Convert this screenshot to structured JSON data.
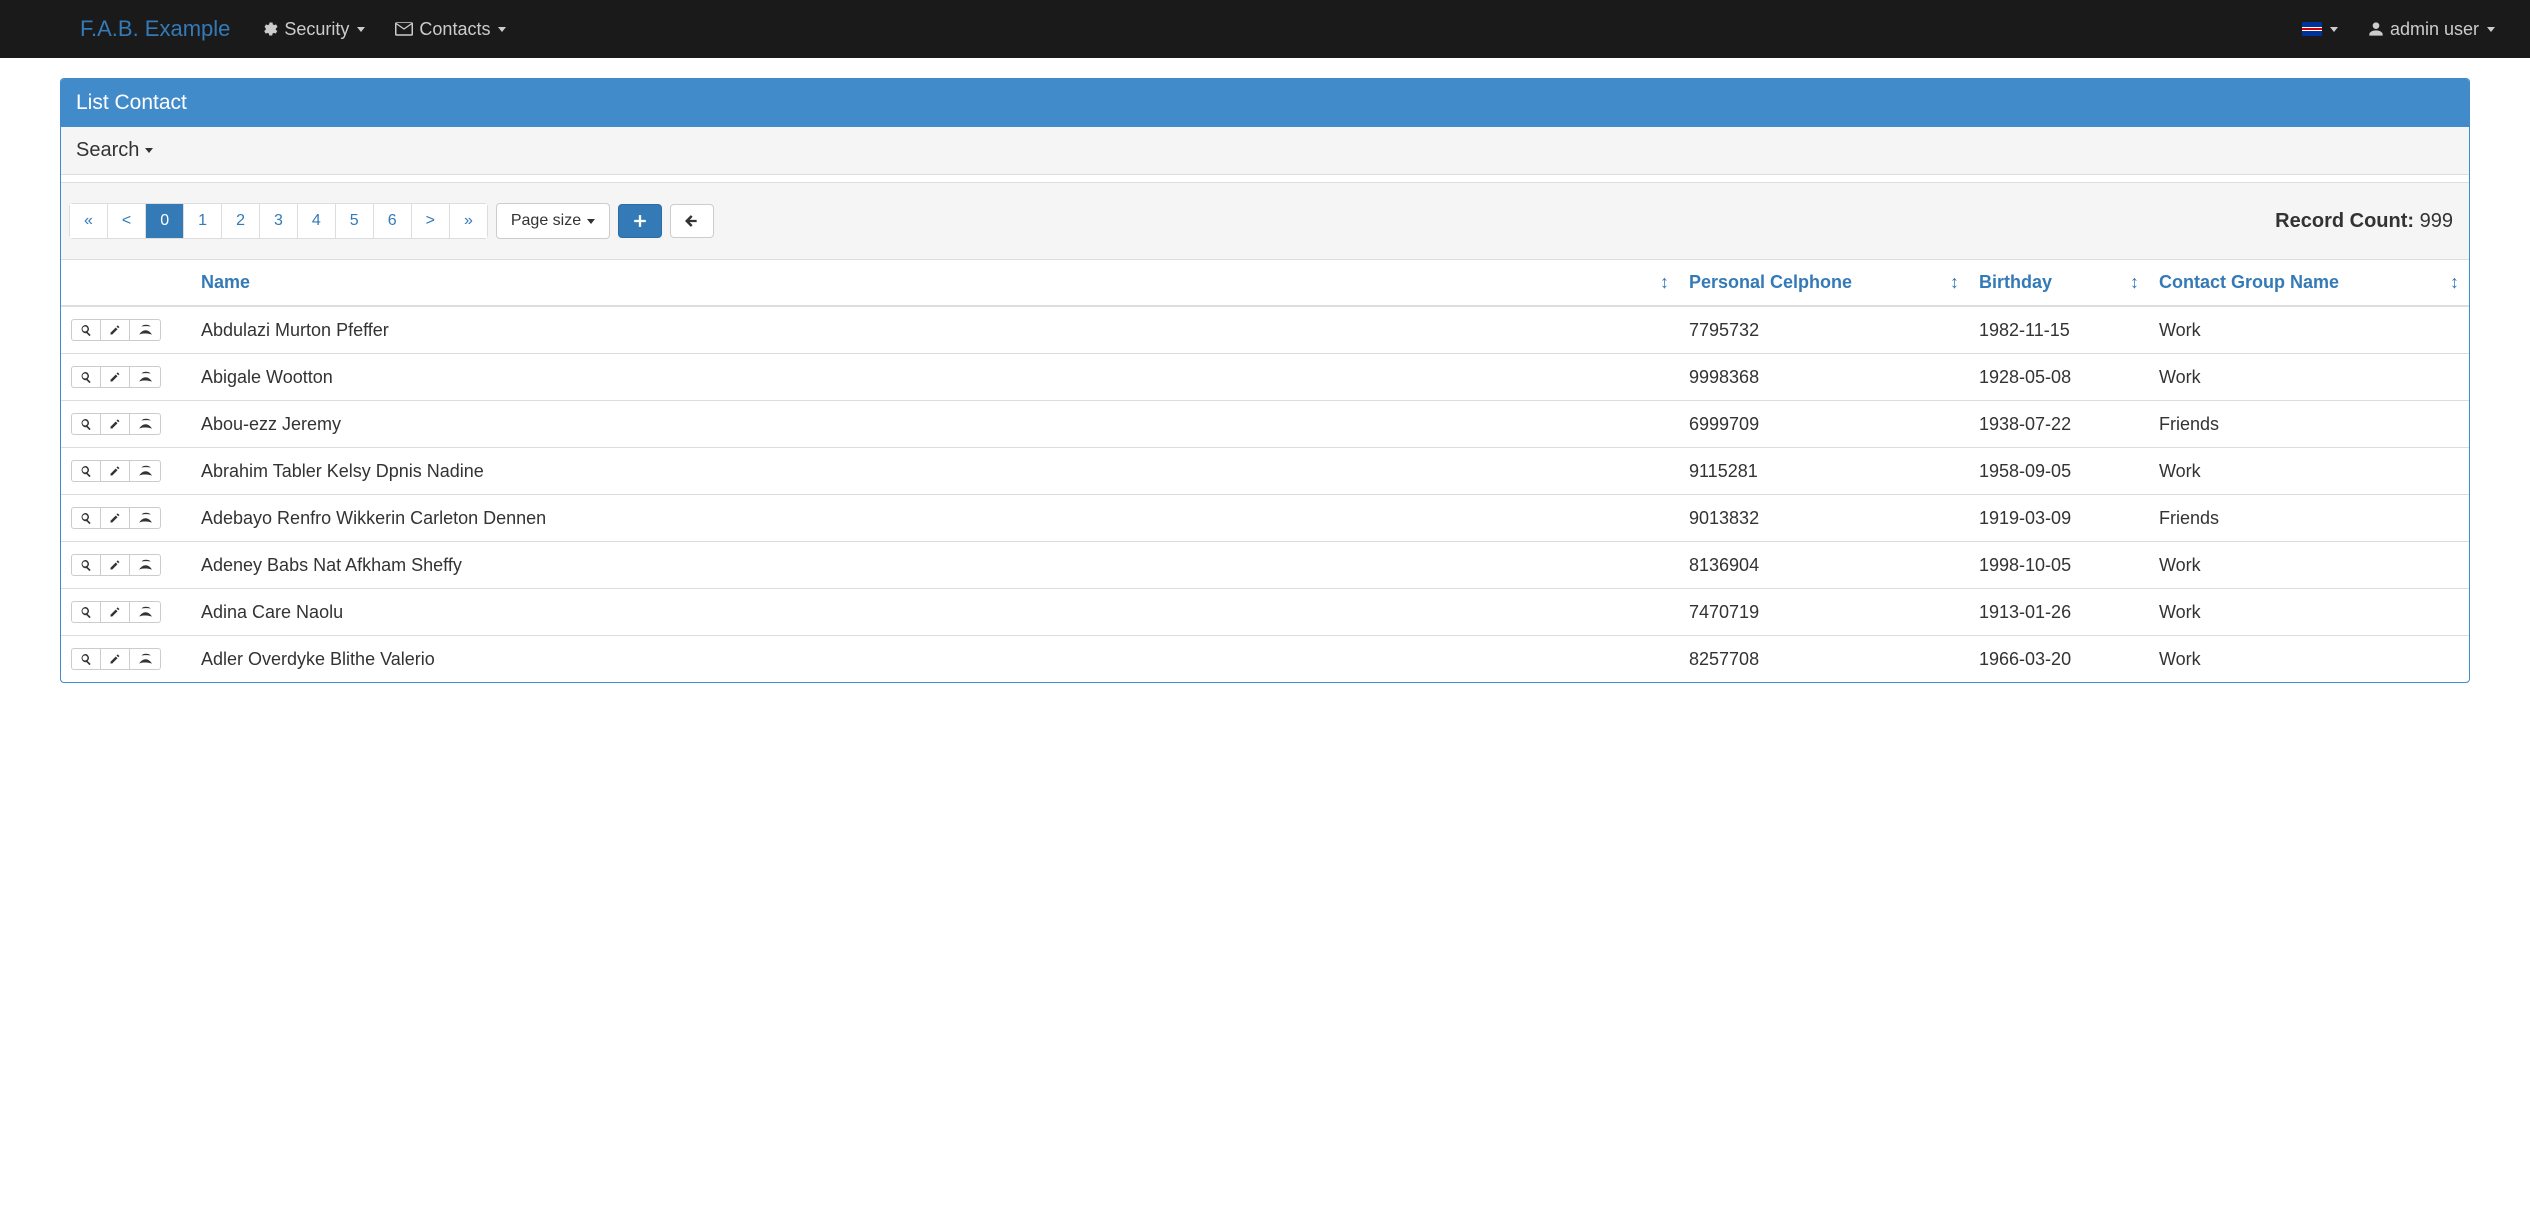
{
  "navbar": {
    "brand": "F.A.B. Example",
    "security": "Security",
    "contacts": "Contacts",
    "user": "admin user"
  },
  "panel": {
    "title": "List Contact",
    "search": "Search"
  },
  "toolbar": {
    "pages": [
      "«",
      "<",
      "0",
      "1",
      "2",
      "3",
      "4",
      "5",
      "6",
      ">",
      "»"
    ],
    "active_page_index": 2,
    "page_size_label": "Page size",
    "record_count_label": "Record Count:",
    "record_count_value": "999"
  },
  "columns": {
    "name": "Name",
    "celphone": "Personal Celphone",
    "birthday": "Birthday",
    "group": "Contact Group Name"
  },
  "rows": [
    {
      "name": "Abdulazi Murton Pfeffer",
      "celphone": "7795732",
      "birthday": "1982-11-15",
      "group": "Work"
    },
    {
      "name": "Abigale Wootton",
      "celphone": "9998368",
      "birthday": "1928-05-08",
      "group": "Work"
    },
    {
      "name": "Abou-ezz Jeremy",
      "celphone": "6999709",
      "birthday": "1938-07-22",
      "group": "Friends"
    },
    {
      "name": "Abrahim Tabler Kelsy Dpnis Nadine",
      "celphone": "9115281",
      "birthday": "1958-09-05",
      "group": "Work"
    },
    {
      "name": "Adebayo Renfro Wikkerin Carleton Dennen",
      "celphone": "9013832",
      "birthday": "1919-03-09",
      "group": "Friends"
    },
    {
      "name": "Adeney Babs Nat Afkham Sheffy",
      "celphone": "8136904",
      "birthday": "1998-10-05",
      "group": "Work"
    },
    {
      "name": "Adina Care Naolu",
      "celphone": "7470719",
      "birthday": "1913-01-26",
      "group": "Work"
    },
    {
      "name": "Adler Overdyke Blithe Valerio",
      "celphone": "8257708",
      "birthday": "1966-03-20",
      "group": "Work"
    }
  ]
}
